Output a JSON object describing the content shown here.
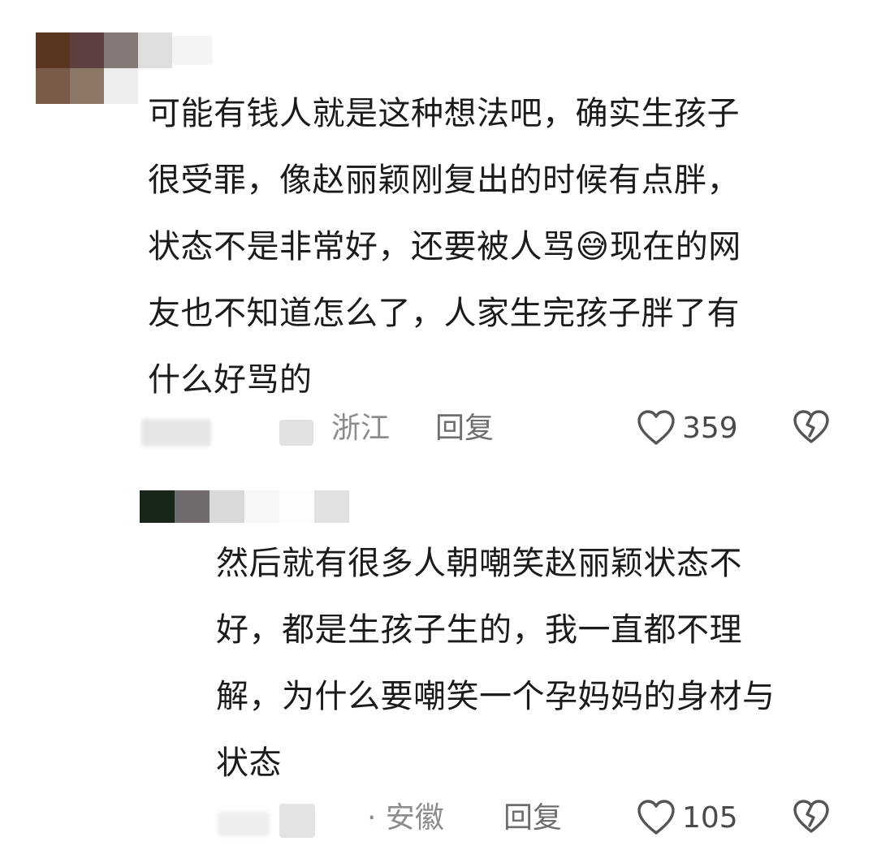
{
  "comments": [
    {
      "text": "可能有钱人就是这种想法吧，确实生孩子\n很受罪，像赵丽颖刚复出的时候有点胖，\n状态不是非常好，还要被人骂😅现在的网\n友也不知道怎么了，人家生完孩子胖了有\n什么好骂的",
      "location": "浙江",
      "reply_label": "回复",
      "likes": "359",
      "like_icon": "heart-outline-icon",
      "dislike_icon": "broken-heart-icon"
    },
    {
      "text": "然后就有很多人朝嘲笑赵丽颖状态不\n好，都是生孩子生的，我一直都不理\n解，为什么要嘲笑一个孕妈妈的身材与\n状态",
      "location": "· 安徽",
      "reply_label": "回复",
      "likes": "105",
      "like_icon": "heart-outline-icon",
      "dislike_icon": "broken-heart-icon"
    }
  ],
  "colors": {
    "text": "#1b1b1b",
    "meta": "#8c8c8c",
    "icon": "#555555"
  }
}
